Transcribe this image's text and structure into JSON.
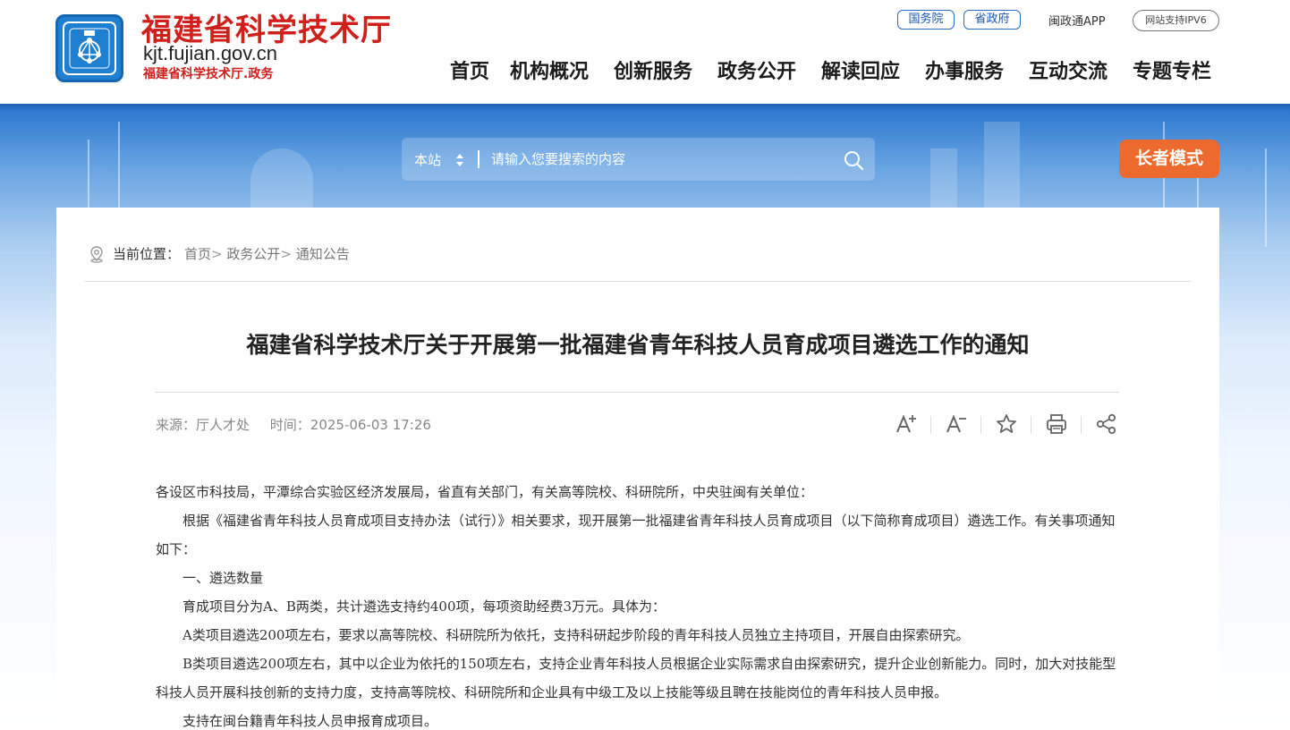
{
  "site": {
    "title": "福建省科学技术厅",
    "domain": "kjt.fujian.gov.cn",
    "subtitle": "福建省科学技术厅.政务"
  },
  "top_links": {
    "state_council": "国务院",
    "provincial_gov": "省政府",
    "app": "闽政通APP",
    "ipv6": "网站支持IPV6"
  },
  "nav": [
    {
      "label": "首页"
    },
    {
      "label": "机构概况"
    },
    {
      "label": "创新服务"
    },
    {
      "label": "政务公开"
    },
    {
      "label": "解读回应"
    },
    {
      "label": "办事服务"
    },
    {
      "label": "互动交流"
    },
    {
      "label": "专题专栏"
    }
  ],
  "search": {
    "scope": "本站",
    "placeholder": "请输入您要搜索的内容"
  },
  "elder_mode": "长者模式",
  "breadcrumb": {
    "label": "当前位置：",
    "items": [
      {
        "label": "首页"
      },
      {
        "label": "政务公开"
      },
      {
        "label": "通知公告"
      }
    ],
    "separator": ">"
  },
  "article": {
    "title": "福建省科学技术厅关于开展第一批福建省青年科技人员育成项目遴选工作的通知",
    "source": "来源：厅人才处",
    "time": "时间：2025-06-03 17:26",
    "paragraphs": [
      "各设区市科技局，平潭综合实验区经济发展局，省直有关部门，有关高等院校、科研院所，中央驻闽有关单位：",
      "根据《福建省青年科技人员育成项目支持办法（试行）》相关要求，现开展第一批福建省青年科技人员育成项目（以下简称育成项目）遴选工作。有关事项通知如下：",
      "一、遴选数量",
      "育成项目分为A、B两类，共计遴选支持约400项，每项资助经费3万元。具体为：",
      "A类项目遴选200项左右，要求以高等院校、科研院所为依托，支持科研起步阶段的青年科技人员独立主持项目，开展自由探索研究。",
      "B类项目遴选200项左右，其中以企业为依托的150项左右，支持企业青年科技人员根据企业实际需求自由探索研究，提升企业创新能力。同时，加大对技能型科技人员开展科技创新的支持力度，支持高等院校、科研院所和企业具有中级工及以上技能等级且聘在技能岗位的青年科技人员申报。",
      "支持在闽台籍青年科技人员申报育成项目。"
    ]
  },
  "tools": [
    {
      "icon": "font-increase-icon"
    },
    {
      "icon": "font-decrease-icon"
    },
    {
      "icon": "star-icon"
    },
    {
      "icon": "print-icon"
    },
    {
      "icon": "share-icon"
    }
  ],
  "colors": {
    "brand_red": "#d0201c",
    "nav_blue": "#1a56b0",
    "elder_orange": "#ec6a2e",
    "banner_blue": "#2f79cf"
  }
}
